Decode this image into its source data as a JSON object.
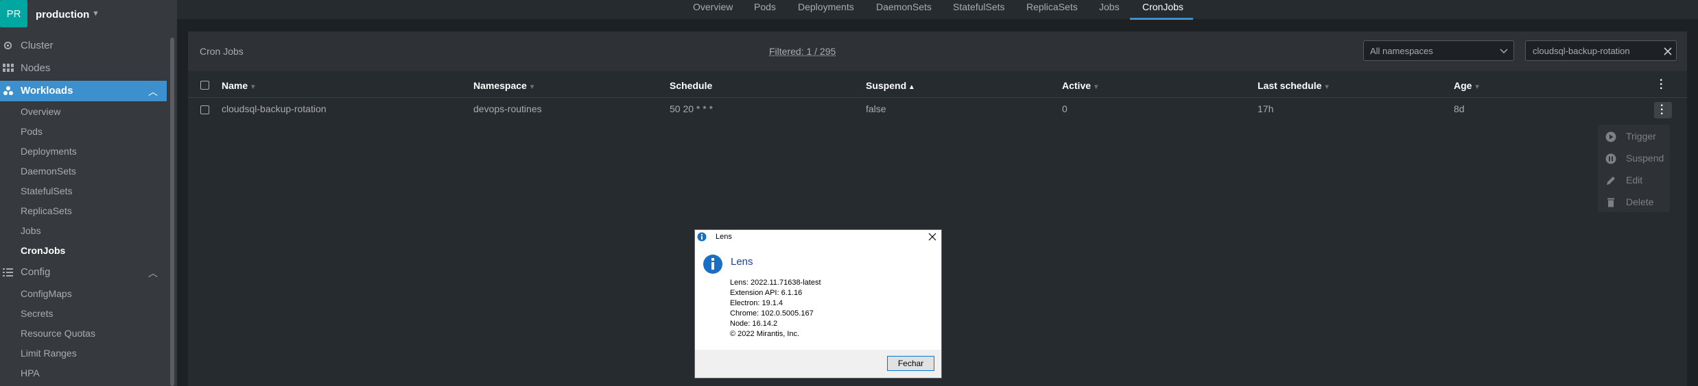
{
  "cluster": {
    "avatar": "PR",
    "name": "production"
  },
  "sidebar": {
    "cluster": "Cluster",
    "nodes": "Nodes",
    "workloads": "Workloads",
    "workload_items": [
      "Overview",
      "Pods",
      "Deployments",
      "DaemonSets",
      "StatefulSets",
      "ReplicaSets",
      "Jobs",
      "CronJobs"
    ],
    "config": "Config",
    "config_items": [
      "ConfigMaps",
      "Secrets",
      "Resource Quotas",
      "Limit Ranges",
      "HPA"
    ]
  },
  "tabs": [
    "Overview",
    "Pods",
    "Deployments",
    "DaemonSets",
    "StatefulSets",
    "ReplicaSets",
    "Jobs",
    "CronJobs"
  ],
  "active_tab": "CronJobs",
  "panel": {
    "title": "Cron Jobs",
    "filtered": "Filtered: 1 / 295",
    "namespace_select": "All namespaces",
    "search_value": "cloudsql-backup-rotation"
  },
  "table": {
    "headers": [
      "Name",
      "Namespace",
      "Schedule",
      "Suspend",
      "Active",
      "Last schedule",
      "Age"
    ],
    "rows": [
      [
        "cloudsql-backup-rotation",
        "devops-routines",
        "50 20 * * *",
        "false",
        "0",
        "17h",
        "8d"
      ]
    ]
  },
  "context_menu": [
    "Trigger",
    "Suspend",
    "Edit",
    "Delete"
  ],
  "dialog": {
    "window_title": "Lens",
    "heading": "Lens",
    "lines": [
      "Lens: 2022.11.71638-latest",
      "Extension API: 6.1.16",
      "Electron: 19.1.4",
      "Chrome: 102.0.5005.167",
      "Node: 16.14.2",
      "© 2022 Mirantis, Inc."
    ],
    "ok_label": "Fechar"
  },
  "colors": {
    "accent": "#3d90ce",
    "avatar": "#00a7a0",
    "sidebar": "#36393e",
    "main": "#262b2f"
  }
}
